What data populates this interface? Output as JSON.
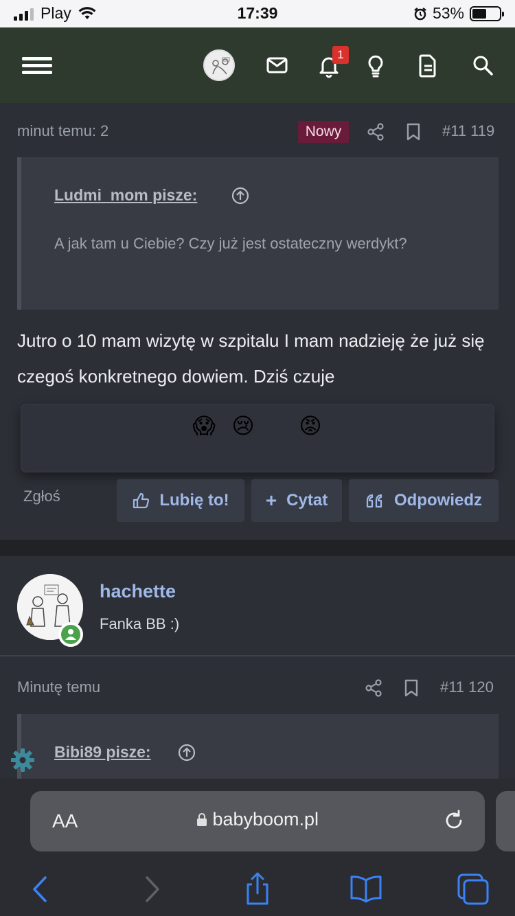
{
  "status_bar": {
    "carrier": "Play",
    "time": "17:39",
    "battery": "53%",
    "battery_level": 0.53
  },
  "header": {
    "notification_count": "1"
  },
  "post1": {
    "time": "minut temu: 2",
    "new_label": "Nowy",
    "number": "#11 119",
    "quote_author": "Ludmi_mom pisze:",
    "quote_text": "A jak tam u Ciebie? Czy już jest ostateczny werdykt?",
    "body": "Jutro o 10 mam wizytę w szpitalu I mam nadzieję że już się czegoś konkretnego dowiem. Dziś czuje"
  },
  "reactions": [
    "😱",
    "😢",
    "😡"
  ],
  "actions": {
    "report": "Zgłoś",
    "like": "Lubię to!",
    "quote": "Cytat",
    "reply": "Odpowiedz"
  },
  "user": {
    "name": "hachette",
    "title": "Fanka BB :)"
  },
  "post2": {
    "time": "Minutę temu",
    "number": "#11 120",
    "quote_author": "Bibi89 pisze:"
  },
  "browser": {
    "aa": "AA",
    "url": "babyboom.pl"
  }
}
